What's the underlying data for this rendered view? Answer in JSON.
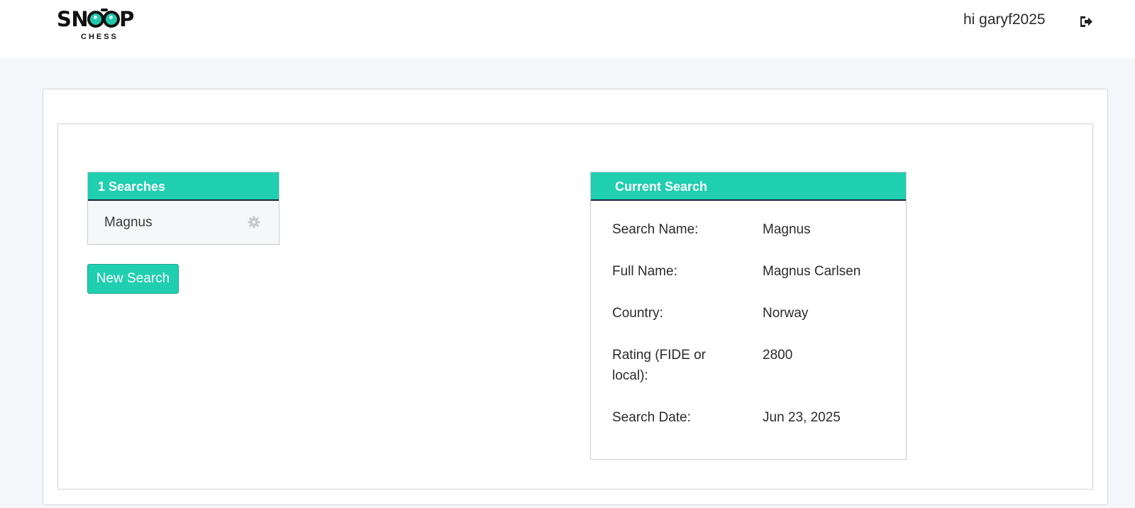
{
  "header": {
    "logo_text_main": "SNOOP",
    "logo_text_sub": "CHESS",
    "greeting": "hi garyf2025",
    "logout_icon": "logout-icon"
  },
  "searches_panel": {
    "title": "1 Searches",
    "items": [
      {
        "label": "Magnus",
        "icon": "gear-icon"
      }
    ]
  },
  "new_search_button": "New Search",
  "current_search": {
    "title": "Current Search",
    "fields": {
      "search_name": {
        "label": "Search Name:",
        "value": "Magnus"
      },
      "full_name": {
        "label": "Full Name:",
        "value": "Magnus Carlsen"
      },
      "country": {
        "label": "Country:",
        "value": "Norway"
      },
      "rating": {
        "label": "Rating (FIDE or local):",
        "value": "2800"
      },
      "search_date": {
        "label": "Search Date:",
        "value": "Jun 23, 2025"
      }
    }
  },
  "colors": {
    "accent": "#20ceb0",
    "page_bg": "#f5f6f9",
    "header_rule": "#17263a"
  }
}
